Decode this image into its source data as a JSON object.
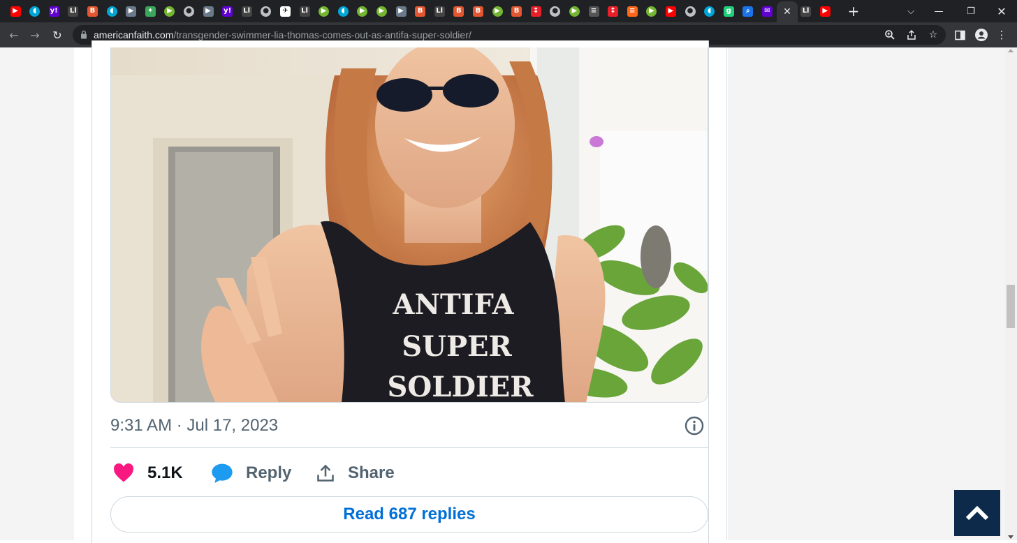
{
  "browser": {
    "tabs": [
      {
        "icon": "youtube-icon",
        "color": "#ff0000",
        "glyph": "▶"
      },
      {
        "icon": "shield-icon",
        "color": "#00a6d6",
        "glyph": "◖"
      },
      {
        "icon": "yahoo-icon",
        "color": "#6001d2",
        "glyph": "y!"
      },
      {
        "icon": "bitchute-icon",
        "color": "#444444",
        "glyph": "Ll"
      },
      {
        "icon": "breitbart-icon",
        "color": "#e3562f",
        "glyph": "B"
      },
      {
        "icon": "shield-icon",
        "color": "#00a6d6",
        "glyph": "◖"
      },
      {
        "icon": "video-icon",
        "color": "#6a7a8a",
        "glyph": "▶"
      },
      {
        "icon": "map-icon",
        "color": "#3aa75a",
        "glyph": "✦"
      },
      {
        "icon": "rumble-icon",
        "color": "#74b532",
        "glyph": "▶"
      },
      {
        "icon": "globe-icon",
        "color": "#bdc1c6",
        "glyph": "●"
      },
      {
        "icon": "video-icon",
        "color": "#6a7a8a",
        "glyph": "▶"
      },
      {
        "icon": "yahoo-icon",
        "color": "#6001d2",
        "glyph": "y!"
      },
      {
        "icon": "bitchute-icon",
        "color": "#444444",
        "glyph": "Ll"
      },
      {
        "icon": "globe-icon",
        "color": "#bdc1c6",
        "glyph": "●"
      },
      {
        "icon": "runner-icon",
        "color": "#ffffff",
        "glyph": "✈"
      },
      {
        "icon": "bitchute-icon",
        "color": "#444444",
        "glyph": "Ll"
      },
      {
        "icon": "rumble-icon",
        "color": "#74b532",
        "glyph": "▶"
      },
      {
        "icon": "shield-icon",
        "color": "#00a6d6",
        "glyph": "◖"
      },
      {
        "icon": "rumble-icon",
        "color": "#74b532",
        "glyph": "▶"
      },
      {
        "icon": "rumble-icon",
        "color": "#74b532",
        "glyph": "▶"
      },
      {
        "icon": "video-icon",
        "color": "#6a7a8a",
        "glyph": "▶"
      },
      {
        "icon": "breitbart-icon",
        "color": "#e3562f",
        "glyph": "B"
      },
      {
        "icon": "bitchute-icon",
        "color": "#444444",
        "glyph": "Ll"
      },
      {
        "icon": "breitbart-icon",
        "color": "#e3562f",
        "glyph": "B"
      },
      {
        "icon": "breitbart-icon",
        "color": "#e3562f",
        "glyph": "B"
      },
      {
        "icon": "rumble-icon",
        "color": "#74b532",
        "glyph": "▶"
      },
      {
        "icon": "breitbart-icon",
        "color": "#e3562f",
        "glyph": "B"
      },
      {
        "icon": "gettr-icon",
        "color": "#e8202a",
        "glyph": "↕"
      },
      {
        "icon": "globe-icon",
        "color": "#bdc1c6",
        "glyph": "●"
      },
      {
        "icon": "rumble-icon",
        "color": "#74b532",
        "glyph": "▶"
      },
      {
        "icon": "news-icon",
        "color": "#555555",
        "glyph": "≡"
      },
      {
        "icon": "gettr-icon",
        "color": "#e8202a",
        "glyph": "↕"
      },
      {
        "icon": "stack-icon",
        "color": "#ff6719",
        "glyph": "≡"
      },
      {
        "icon": "rumble-icon",
        "color": "#74b532",
        "glyph": "▶"
      },
      {
        "icon": "youtube-icon",
        "color": "#ff0000",
        "glyph": "▶"
      },
      {
        "icon": "globe-icon",
        "color": "#bdc1c6",
        "glyph": "●"
      },
      {
        "icon": "shield-icon",
        "color": "#00a6d6",
        "glyph": "◖"
      },
      {
        "icon": "gab-icon",
        "color": "#21cf7a",
        "glyph": "g"
      },
      {
        "icon": "search-icon",
        "color": "#1a73e8",
        "glyph": "⌕"
      },
      {
        "icon": "mail-icon",
        "color": "#6001d2",
        "glyph": "✉"
      },
      {
        "icon": "close-icon",
        "color": "#e8eaed",
        "glyph": "✕",
        "active": true
      },
      {
        "icon": "bitchute-icon",
        "color": "#444444",
        "glyph": "Ll"
      },
      {
        "icon": "youtube-icon",
        "color": "#ff0000",
        "glyph": "▶"
      }
    ],
    "new_tab": "+",
    "url_host": "americanfaith.com",
    "url_path": "/transgender-swimmer-lia-thomas-comes-out-as-antifa-super-soldier/"
  },
  "tweet": {
    "image_shirt_text": [
      "ANTIFA",
      "SUPER",
      "SOLDIER"
    ],
    "timestamp": "9:31 AM · Jul 17, 2023",
    "like_count": "5.1K",
    "reply_label": "Reply",
    "share_label": "Share",
    "read_replies_label": "Read 687 replies"
  },
  "colors": {
    "like": "#f91880",
    "reply": "#1d9bf0",
    "link": "#006fd6",
    "muted": "#536471",
    "back_to_top": "#0d2a4a"
  }
}
